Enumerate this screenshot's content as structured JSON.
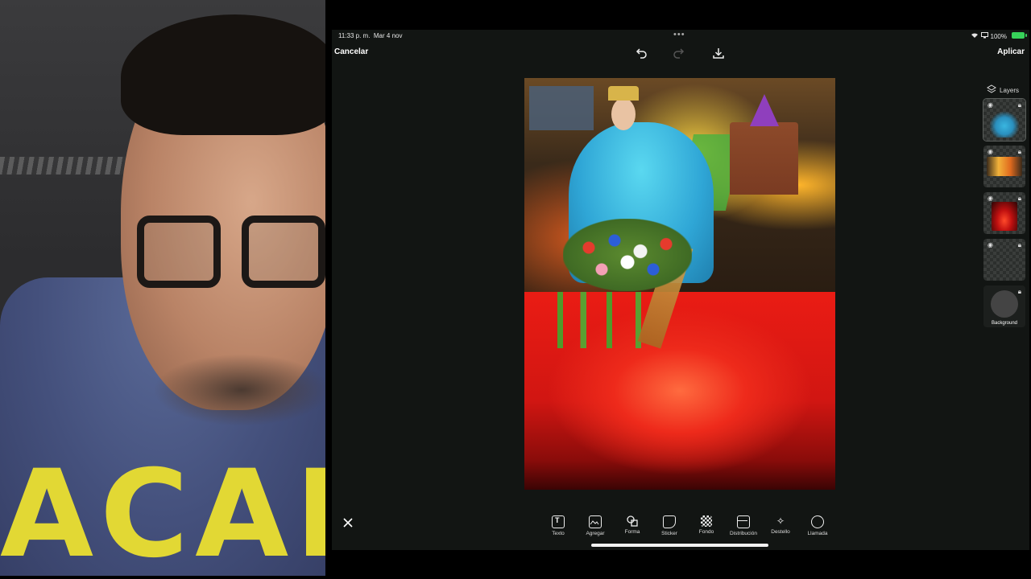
{
  "status_bar": {
    "time": "11:33 p. m.",
    "date": "Mar 4 nov",
    "battery": "100%",
    "battery_color": "#37d25a"
  },
  "top_bar": {
    "cancel_label": "Cancelar",
    "apply_label": "Aplicar",
    "icons": [
      "undo-icon",
      "redo-icon",
      "download-icon"
    ]
  },
  "layers": {
    "header": "Layers",
    "items": [
      {
        "name": "Virgin figure layer",
        "selected": true
      },
      {
        "name": "City night layer",
        "selected": false
      },
      {
        "name": "Red glow layer",
        "selected": false
      },
      {
        "name": "Empty layer",
        "selected": false
      },
      {
        "name": "Background",
        "label": "Background",
        "selected": false
      }
    ]
  },
  "toolbar": {
    "items": [
      {
        "label": "Texto",
        "icon": "text-icon"
      },
      {
        "label": "Agregar",
        "icon": "add-image-icon"
      },
      {
        "label": "Forma",
        "icon": "shape-icon"
      },
      {
        "label": "Sticker",
        "icon": "sticker-icon"
      },
      {
        "label": "Fondo",
        "icon": "background-icon"
      },
      {
        "label": "Distribución",
        "icon": "layout-icon"
      },
      {
        "label": "Destello",
        "icon": "sparkle-icon"
      },
      {
        "label": "Llamada",
        "icon": "callout-icon"
      }
    ]
  },
  "hoodie_text": "ACAD",
  "colors": {
    "app_bg": "#121513",
    "canvas_red": "#ea1c14",
    "robe_blue": "#2fa6d6"
  }
}
